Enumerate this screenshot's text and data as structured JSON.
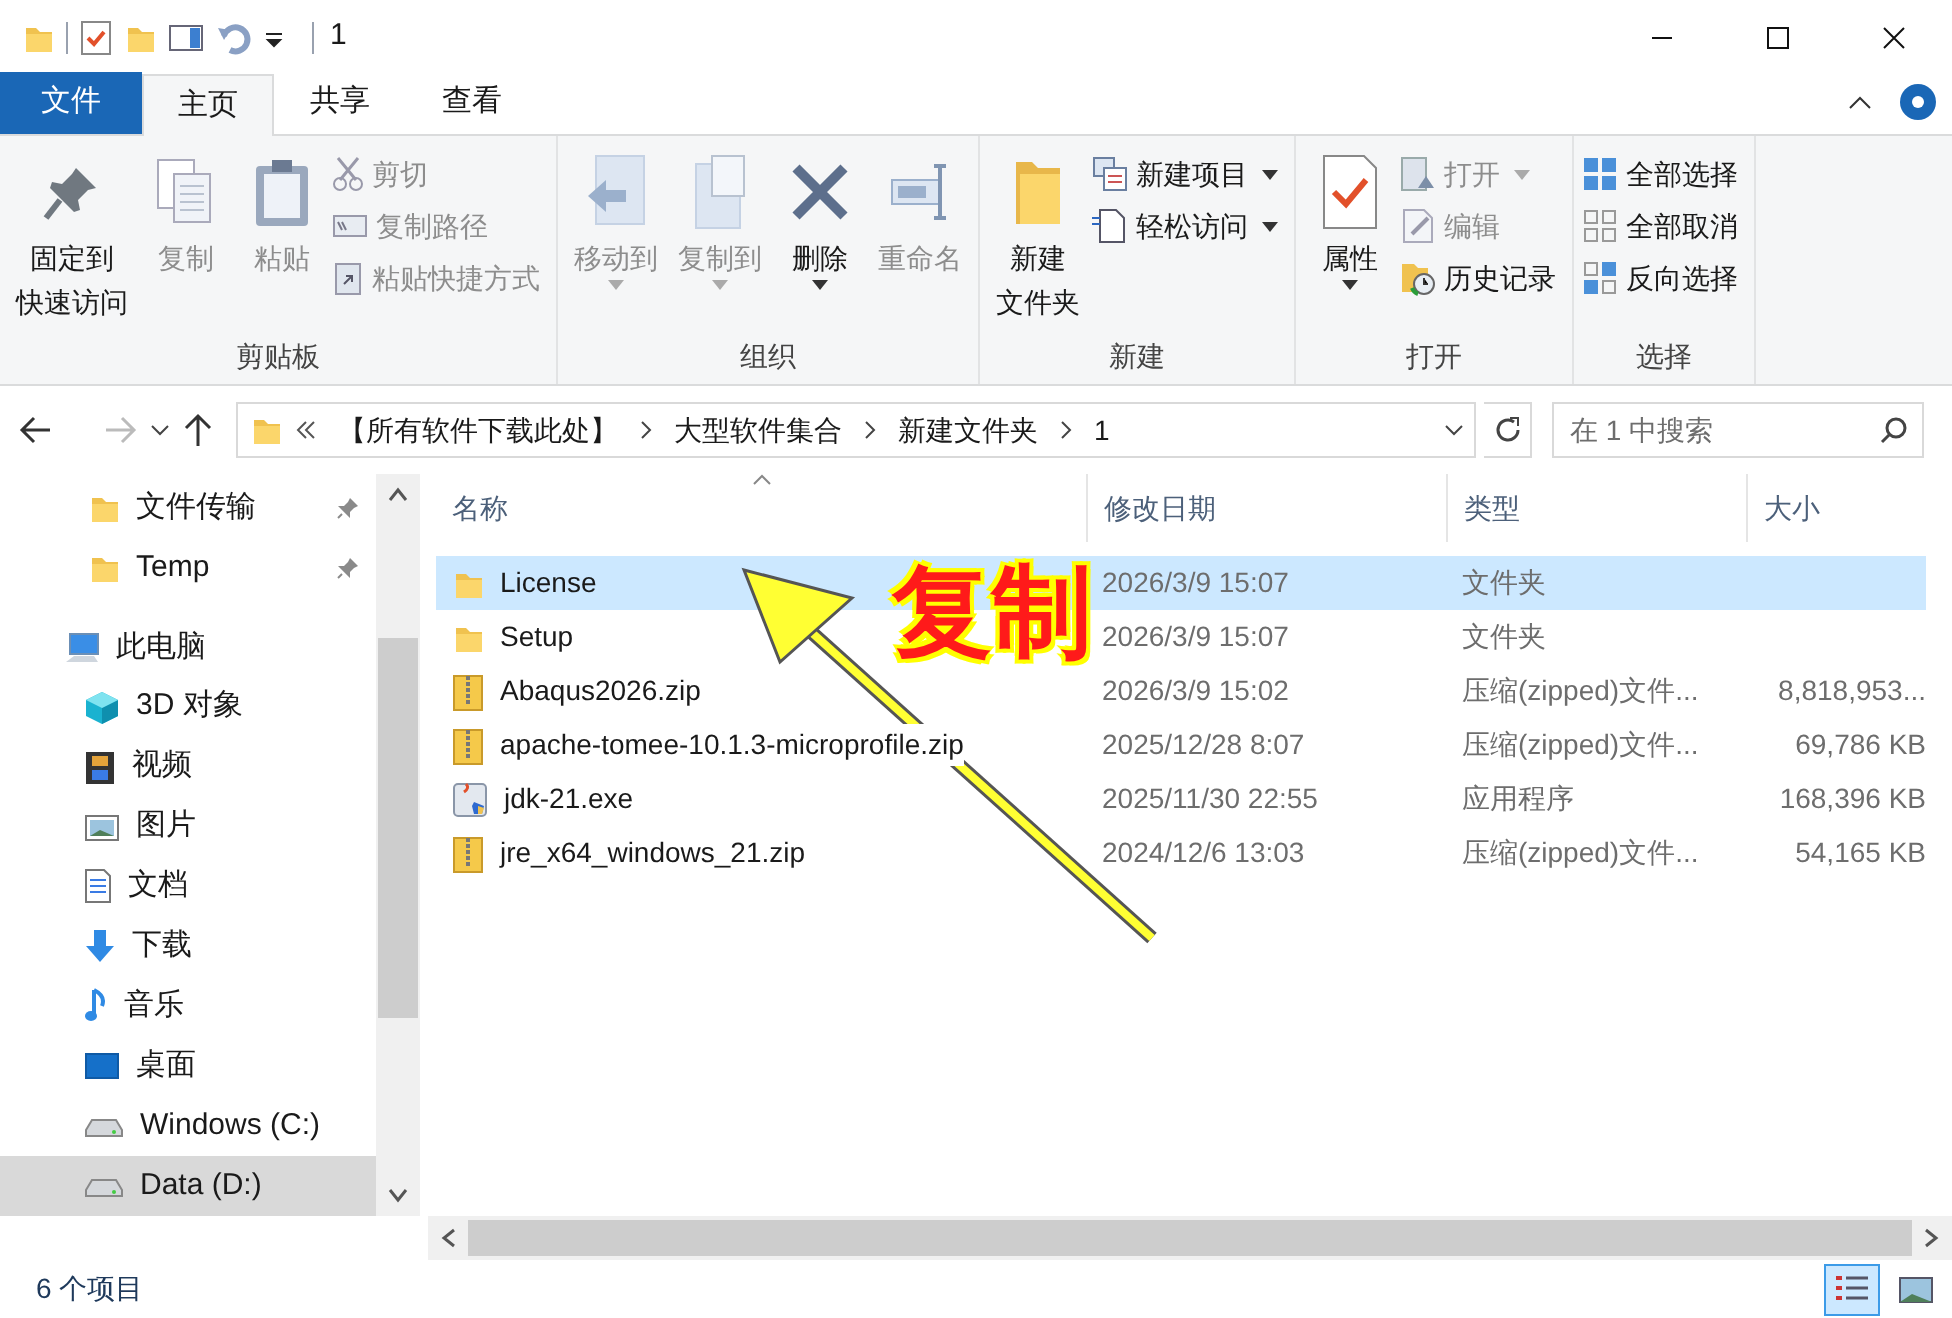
{
  "window": {
    "title": "1"
  },
  "ribbon": {
    "tabs": [
      {
        "label": "文件",
        "kind": "file",
        "selected": false
      },
      {
        "label": "主页",
        "kind": "tab",
        "selected": true
      },
      {
        "label": "共享",
        "kind": "tab",
        "selected": false
      },
      {
        "label": "查看",
        "kind": "tab",
        "selected": false
      }
    ],
    "groups": [
      {
        "label": "剪贴板",
        "items": [
          {
            "label": [
              "固定到",
              "快速访问"
            ],
            "kind": "large",
            "disabled": false
          },
          {
            "label": "复制",
            "kind": "large",
            "disabled": true
          },
          {
            "label": "粘贴",
            "kind": "large",
            "disabled": true
          },
          {
            "label": "剪切",
            "kind": "small",
            "disabled": true
          },
          {
            "label": "复制路径",
            "kind": "small",
            "disabled": true
          },
          {
            "label": "粘贴快捷方式",
            "kind": "small",
            "disabled": true
          }
        ]
      },
      {
        "label": "组织",
        "items": [
          {
            "label": "移动到",
            "kind": "large",
            "disabled": true,
            "dropdown": true
          },
          {
            "label": "复制到",
            "kind": "large",
            "disabled": true,
            "dropdown": true
          },
          {
            "label": "删除",
            "kind": "large",
            "disabled": false,
            "dropdown": true
          },
          {
            "label": "重命名",
            "kind": "large",
            "disabled": true
          }
        ]
      },
      {
        "label": "新建",
        "items": [
          {
            "label": [
              "新建",
              "文件夹"
            ],
            "kind": "large",
            "disabled": false
          },
          {
            "label": "新建项目",
            "kind": "small",
            "disabled": false,
            "dropdown": true
          },
          {
            "label": "轻松访问",
            "kind": "small",
            "disabled": false,
            "dropdown": true
          }
        ]
      },
      {
        "label": "打开",
        "items": [
          {
            "label": "属性",
            "kind": "large",
            "disabled": false,
            "dropdown": true
          },
          {
            "label": "打开",
            "kind": "small",
            "disabled": true,
            "dropdown": true
          },
          {
            "label": "编辑",
            "kind": "small",
            "disabled": true
          },
          {
            "label": "历史记录",
            "kind": "small",
            "disabled": false
          }
        ]
      },
      {
        "label": "选择",
        "items": [
          {
            "label": "全部选择",
            "kind": "small",
            "disabled": false
          },
          {
            "label": "全部取消",
            "kind": "small",
            "disabled": false
          },
          {
            "label": "反向选择",
            "kind": "small",
            "disabled": false
          }
        ]
      }
    ]
  },
  "address": {
    "breadcrumbs": [
      "【所有软件下载此处】",
      "大型软件集合",
      "新建文件夹",
      "1"
    ],
    "search_placeholder": "在 1 中搜索"
  },
  "navigation": [
    {
      "label": "文件传输",
      "kind": "folder",
      "pinned": true,
      "selected": false
    },
    {
      "label": "Temp",
      "kind": "folder",
      "pinned": true,
      "selected": false
    },
    {
      "label": "此电脑",
      "kind": "pc",
      "pinned": false,
      "selected": false
    },
    {
      "label": "3D 对象",
      "kind": "cube",
      "pinned": false,
      "selected": false
    },
    {
      "label": "视频",
      "kind": "video",
      "pinned": false,
      "selected": false
    },
    {
      "label": "图片",
      "kind": "image",
      "pinned": false,
      "selected": false
    },
    {
      "label": "文档",
      "kind": "doc",
      "pinned": false,
      "selected": false
    },
    {
      "label": "下载",
      "kind": "download",
      "pinned": false,
      "selected": false
    },
    {
      "label": "音乐",
      "kind": "music",
      "pinned": false,
      "selected": false
    },
    {
      "label": "桌面",
      "kind": "desktop",
      "pinned": false,
      "selected": false
    },
    {
      "label": "Windows (C:)",
      "kind": "drive",
      "pinned": false,
      "selected": false
    },
    {
      "label": "Data (D:)",
      "kind": "drive",
      "pinned": false,
      "selected": true
    }
  ],
  "table": {
    "columns": [
      "名称",
      "修改日期",
      "类型",
      "大小"
    ],
    "rows": [
      {
        "kind": "folder",
        "selected": true,
        "cells": [
          "License",
          "2026/3/9 15:07",
          "文件夹",
          ""
        ]
      },
      {
        "kind": "folder",
        "selected": false,
        "cells": [
          "Setup",
          "2026/3/9 15:07",
          "文件夹",
          ""
        ]
      },
      {
        "kind": "zip",
        "selected": false,
        "cells": [
          "Abaqus2026.zip",
          "2026/3/9 15:02",
          "压缩(zipped)文件...",
          "8,818,953..."
        ]
      },
      {
        "kind": "zip",
        "selected": false,
        "cells": [
          "apache-tomee-10.1.3-microprofile.zip",
          "2025/12/28 8:07",
          "压缩(zipped)文件...",
          "69,786 KB"
        ]
      },
      {
        "kind": "exe",
        "selected": false,
        "cells": [
          "jdk-21.exe",
          "2025/11/30 22:55",
          "应用程序",
          "168,396 KB"
        ]
      },
      {
        "kind": "zip",
        "selected": false,
        "cells": [
          "jre_x64_windows_21.zip",
          "2024/12/6 13:03",
          "压缩(zipped)文件...",
          "54,165 KB"
        ]
      }
    ]
  },
  "annotation": {
    "label": "复制"
  },
  "status_bar": {
    "count": "6 个项目",
    "views": [
      {
        "kind": "details",
        "selected": true
      },
      {
        "kind": "thumbnails",
        "selected": false
      }
    ]
  }
}
